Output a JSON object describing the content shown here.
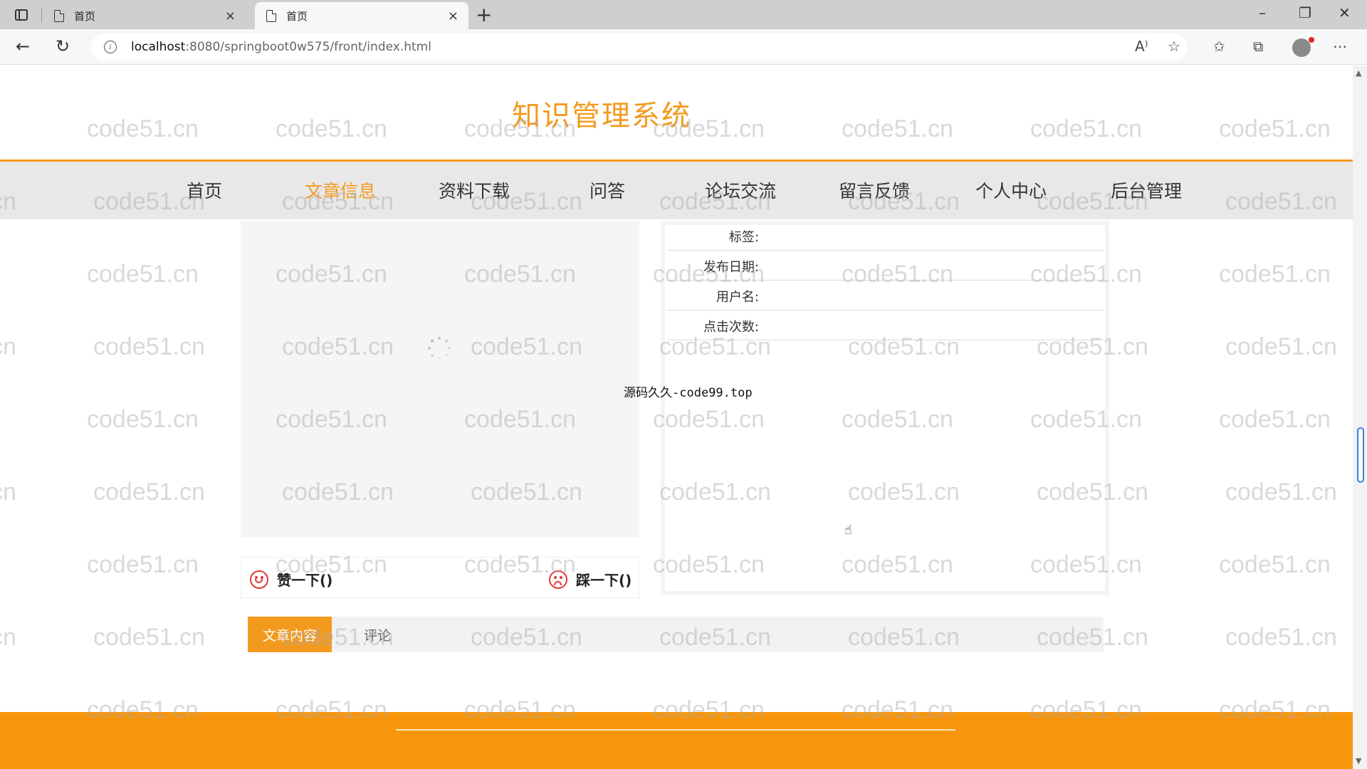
{
  "browser": {
    "tabs": [
      {
        "title": "首页",
        "close": "×"
      },
      {
        "title": "首页",
        "close": "×"
      }
    ],
    "new_tab": "+",
    "window": {
      "minimize": "–",
      "restore": "❐",
      "close": "✕"
    },
    "nav": {
      "back": "←",
      "reload": "↻"
    },
    "url_host": "localhost",
    "url_path": ":8080/springboot0w575/front/index.html",
    "info": "i",
    "toolbar_icons": [
      "A⁾",
      "☆",
      "✩",
      "⧉",
      "⋯"
    ]
  },
  "site": {
    "title": "知识管理系统",
    "nav": [
      "首页",
      "文章信息",
      "资料下载",
      "问答",
      "论坛交流",
      "留言反馈",
      "个人中心",
      "后台管理"
    ],
    "active_nav": "文章信息"
  },
  "article": {
    "fields": [
      {
        "label": "标签:",
        "value": ""
      },
      {
        "label": "发布日期:",
        "value": ""
      },
      {
        "label": "用户名:",
        "value": ""
      },
      {
        "label": "点击次数:",
        "value": ""
      }
    ],
    "source": "源码久久-code99.top",
    "like_label": "赞一下()",
    "dislike_label": "踩一下()",
    "tabs": [
      "文章内容",
      "评论"
    ]
  },
  "watermark": "code51.cn",
  "colors": {
    "accent": "#f39a1e",
    "footer": "#f7960c",
    "vote_icon": "#e23a3a"
  }
}
